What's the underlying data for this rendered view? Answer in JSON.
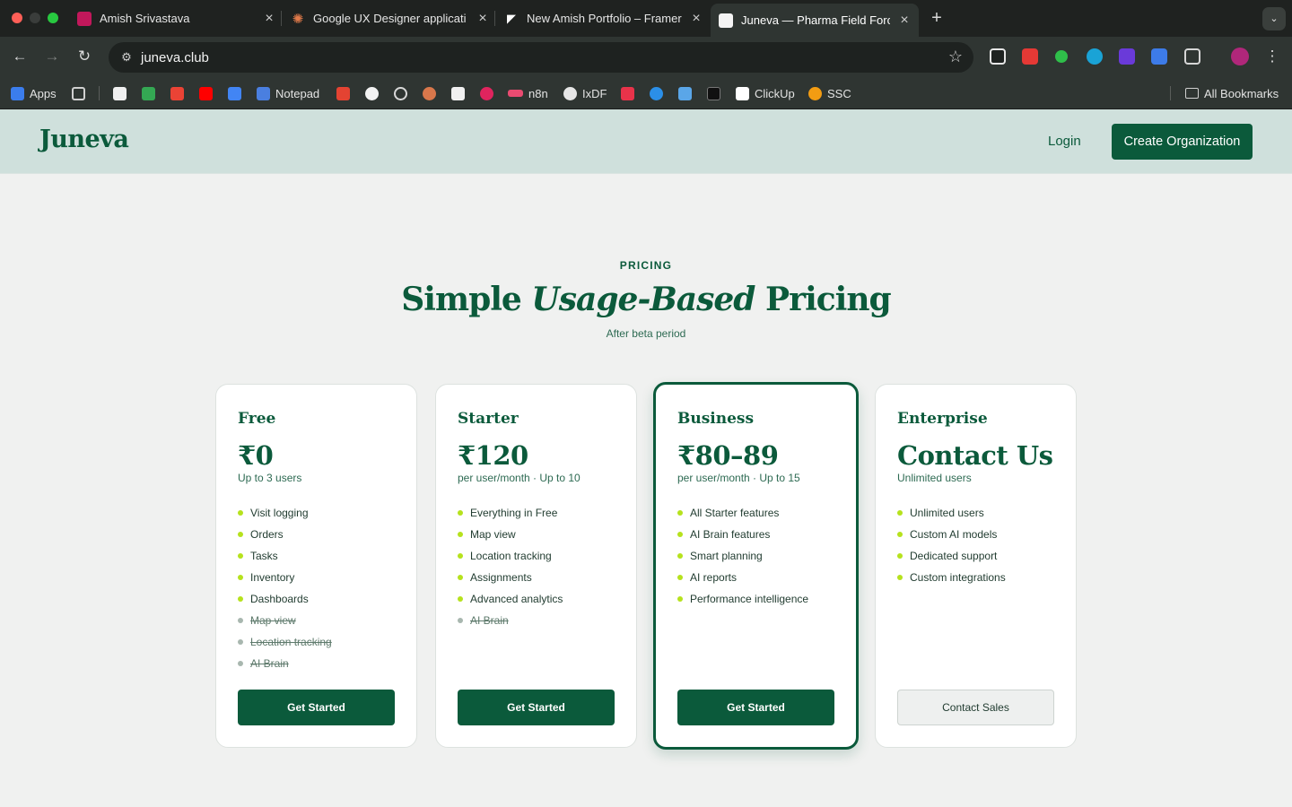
{
  "browser": {
    "tabs": [
      {
        "title": "Amish Srivastava"
      },
      {
        "title": "Google UX Designer applicati"
      },
      {
        "title": "New Amish Portfolio – Framer"
      },
      {
        "title": "Juneva — Pharma Field Force"
      }
    ],
    "url": "juneva.club",
    "bookmarks": {
      "apps": "Apps",
      "notepad": "Notepad",
      "n8n": "n8n",
      "ixdf": "IxDF",
      "clickup": "ClickUp",
      "ssc": "SSC",
      "all_bookmarks": "All Bookmarks"
    }
  },
  "header": {
    "logo": "Juneva",
    "login": "Login",
    "create_org": "Create Organization"
  },
  "pricing": {
    "eyebrow": "PRICING",
    "headline_pre": "Simple",
    "headline_em": "Usage-Based",
    "headline_post": "Pricing",
    "subline": "After beta period"
  },
  "plans": [
    {
      "name": "Free",
      "price": "₹0",
      "note": "Up to 3 users",
      "features": [
        "Visit logging",
        "Orders",
        "Tasks",
        "Inventory",
        "Dashboards",
        "Map view",
        "Location tracking",
        "AI Brain"
      ],
      "cta": "Get Started"
    },
    {
      "name": "Starter",
      "price": "₹120",
      "note": "per user/month · Up to 10",
      "features": [
        "Everything in Free",
        "Map view",
        "Location tracking",
        "Assignments",
        "Advanced analytics",
        "AI Brain"
      ],
      "cta": "Get Started"
    },
    {
      "name": "Business",
      "price": "₹80–89",
      "note": "per user/month · Up to 15",
      "features": [
        "All Starter features",
        "AI Brain features",
        "Smart planning",
        "AI reports",
        "Performance intelligence"
      ],
      "cta": "Get Started"
    },
    {
      "name": "Enterprise",
      "price": "Contact Us",
      "note": "Unlimited users",
      "features": [
        "Unlimited users",
        "Custom AI models",
        "Dedicated support",
        "Custom integrations"
      ],
      "cta": "Contact Sales"
    }
  ]
}
